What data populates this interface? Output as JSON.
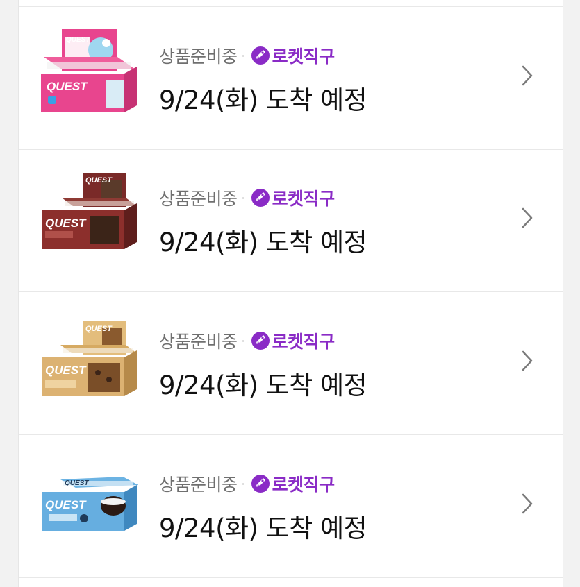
{
  "colors": {
    "rocket_purple": "#8a2bc6",
    "status_gray": "#6f6f6f",
    "text_dark": "#111111"
  },
  "orders": [
    {
      "status": "상품준비중",
      "separator": "·",
      "badge_icon": "rocket-icon",
      "badge_label": "로켓직구",
      "arrival": "9/24(화) 도착 예정",
      "product_image": "pink-box-image",
      "brand_text": "QUEST",
      "box_color": "#e8458e"
    },
    {
      "status": "상품준비중",
      "separator": "·",
      "badge_icon": "rocket-icon",
      "badge_label": "로켓직구",
      "arrival": "9/24(화) 도착 예정",
      "product_image": "brown-box-image",
      "brand_text": "QUEST",
      "box_color": "#7a2a28"
    },
    {
      "status": "상품준비중",
      "separator": "·",
      "badge_icon": "rocket-icon",
      "badge_label": "로켓직구",
      "arrival": "9/24(화) 도착 예정",
      "product_image": "tan-box-image",
      "brand_text": "QUEST",
      "box_color": "#d9b070"
    },
    {
      "status": "상품준비중",
      "separator": "·",
      "badge_icon": "rocket-icon",
      "badge_label": "로켓직구",
      "arrival": "9/24(화) 도착 예정",
      "product_image": "blue-box-image",
      "brand_text": "QUEST",
      "box_color": "#66aee0"
    }
  ]
}
